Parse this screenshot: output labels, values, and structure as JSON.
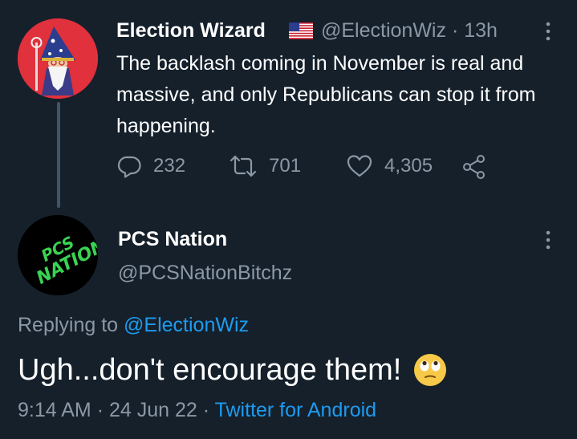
{
  "tweet": {
    "author": {
      "name": "Election Wizard",
      "handle": "@ElectionWiz",
      "time": "13h",
      "flag": "us-flag-emoji"
    },
    "text": "The backlash coming in November is real and massive, and only Republicans can stop it from happening.",
    "stats": {
      "replies": "232",
      "retweets": "701",
      "likes": "4,305"
    },
    "icons": [
      "reply-icon",
      "retweet-icon",
      "like-icon",
      "share-icon",
      "more-icon"
    ]
  },
  "reply": {
    "author": {
      "name": "PCS Nation",
      "handle": "@PCSNationBitchz",
      "avatar_text": "PCS NATION"
    },
    "replying_prefix": "Replying to",
    "replying_to": "@ElectionWiz",
    "text": "Ugh...don't encourage them!",
    "emoji": "face-with-rolling-eyes",
    "time": "9:14 AM",
    "date": "24 Jun 22",
    "source": "Twitter for Android"
  },
  "colors": {
    "background": "#15202b",
    "secondary_text": "#8b98a5",
    "link": "#1d9bf0",
    "thread_line": "#425364"
  }
}
